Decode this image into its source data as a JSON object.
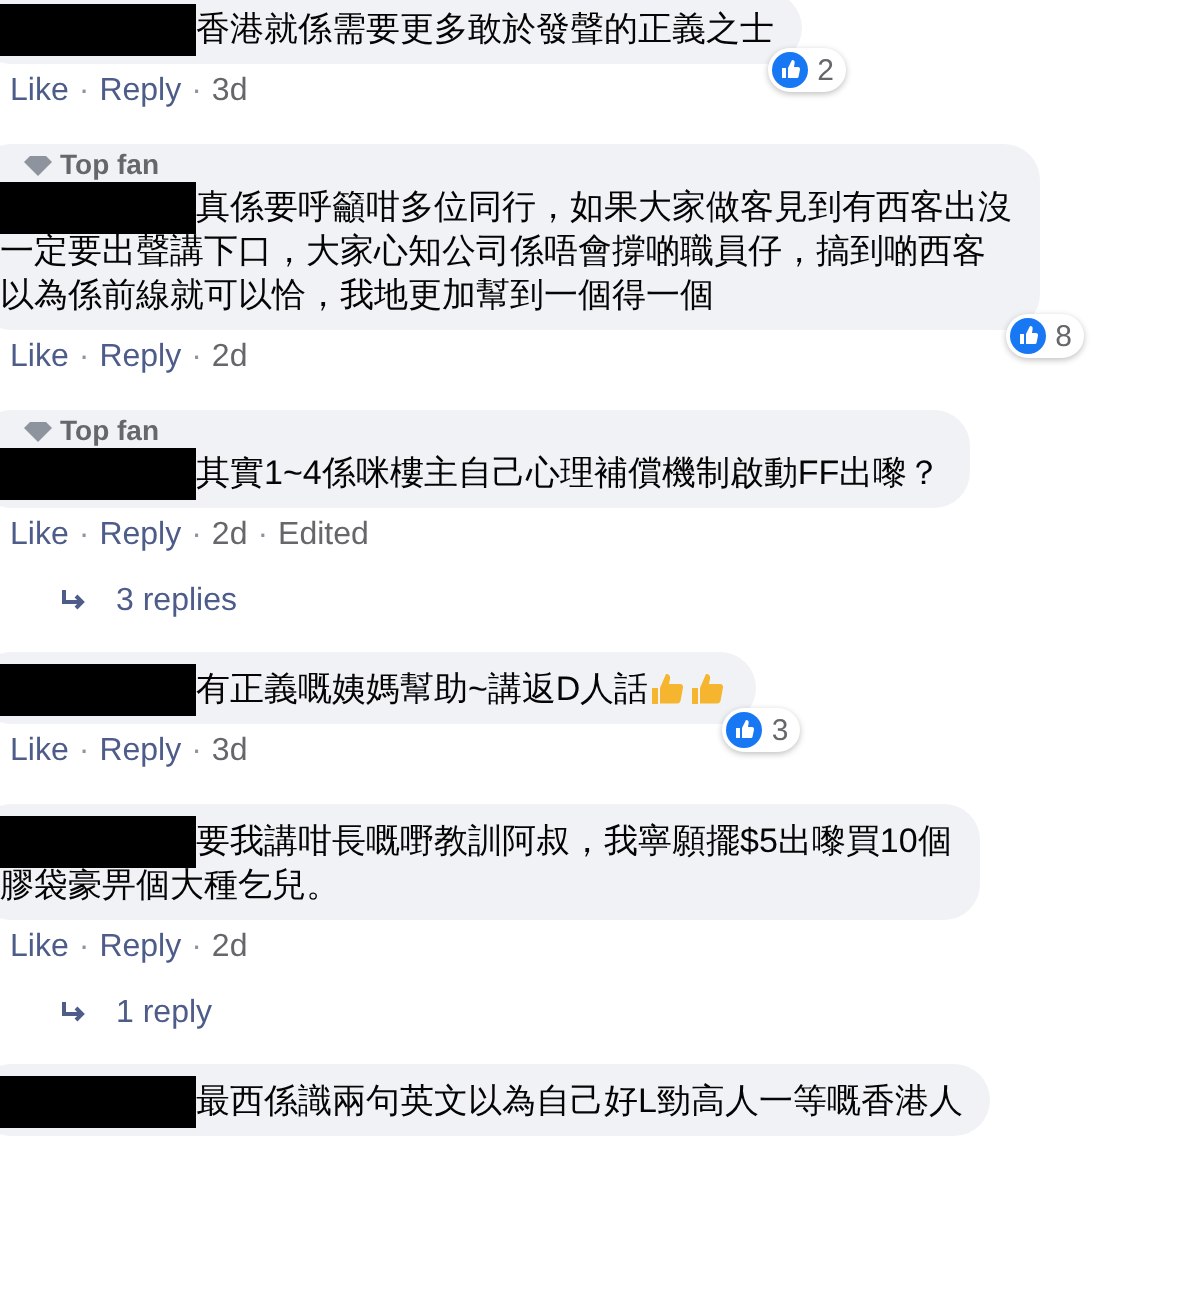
{
  "comments": [
    {
      "lines": [
        "香港就係需要更多敢於發聲的正義之士"
      ],
      "reaction_count": "2",
      "actions": [
        "Like",
        "·",
        "Reply",
        "·",
        "3d"
      ]
    },
    {
      "top_fan": "Top fan",
      "lines": [
        "真係要呼籲咁多位同行，如果大家做客見到有西客出沒",
        "一定要出聲講下口，大家心知公司係唔會撐啲職員仔，搞到啲西客",
        "以為係前線就可以恰，我地更加幫到一個得一個"
      ],
      "reaction_count": "8",
      "actions": [
        "Like",
        "·",
        "Reply",
        "·",
        "2d"
      ]
    },
    {
      "top_fan": "Top fan",
      "lines": [
        "其實1~4係咪樓主自己心理補償機制啟動FF出嚟？"
      ],
      "actions": [
        "Like",
        "·",
        "Reply",
        "·",
        "2d",
        "·",
        "Edited"
      ],
      "replies": "3 replies"
    },
    {
      "lines": [
        "有正義嘅姨媽幫助~講返D人話"
      ],
      "trailing_icons": [
        {
          "kind": "thumbs-up"
        },
        {
          "kind": "thumbs-up"
        }
      ],
      "reaction_count": "3",
      "actions": [
        "Like",
        "·",
        "Reply",
        "·",
        "3d"
      ]
    },
    {
      "lines": [
        "要我講咁長嘅嘢教訓阿叔，我寧願擺$5出嚟買10個",
        "膠袋豪畀個大種乞兒。"
      ],
      "actions": [
        "Like",
        "·",
        "Reply",
        "·",
        "2d"
      ],
      "replies": "1 reply"
    },
    {
      "lines": [
        "最西係識兩句英文以為自己好L勁高人一等嘅香港人"
      ]
    }
  ]
}
